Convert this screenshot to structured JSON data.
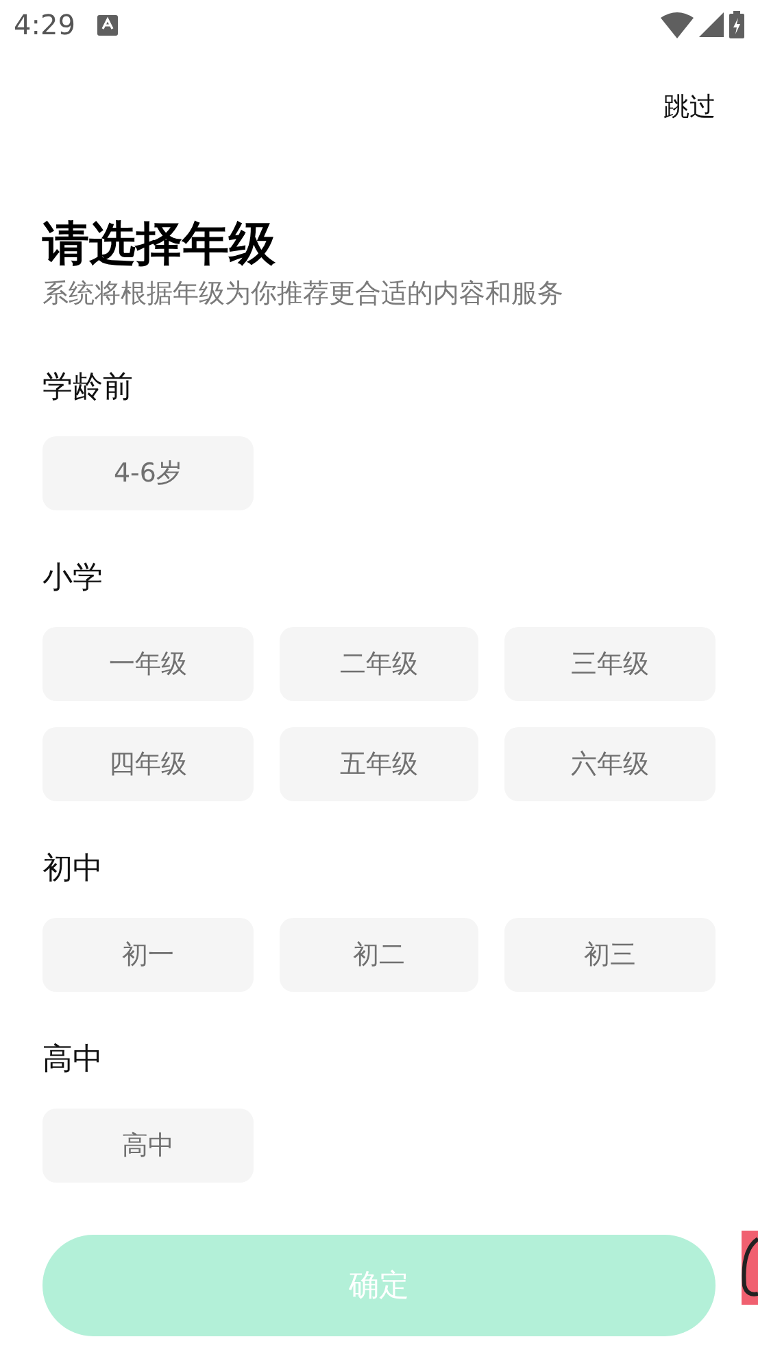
{
  "status_bar": {
    "time": "4:29"
  },
  "skip": "跳过",
  "title": "请选择年级",
  "subtitle": "系统将根据年级为你推荐更合适的内容和服务",
  "sections": [
    {
      "label": "学龄前",
      "options": [
        {
          "label": "4-6岁",
          "selected": false
        }
      ]
    },
    {
      "label": "小学",
      "options": [
        {
          "label": "一年级",
          "selected": false
        },
        {
          "label": "二年级",
          "selected": false
        },
        {
          "label": "三年级",
          "selected": false
        },
        {
          "label": "四年级",
          "selected": false
        },
        {
          "label": "五年级",
          "selected": false
        },
        {
          "label": "六年级",
          "selected": false
        }
      ]
    },
    {
      "label": "初中",
      "options": [
        {
          "label": "初一",
          "selected": false
        },
        {
          "label": "初二",
          "selected": false
        },
        {
          "label": "初三",
          "selected": false
        }
      ]
    },
    {
      "label": "高中",
      "options": [
        {
          "label": "高中",
          "selected": false
        }
      ]
    }
  ],
  "confirm": {
    "label": "确定",
    "disabled": true
  }
}
